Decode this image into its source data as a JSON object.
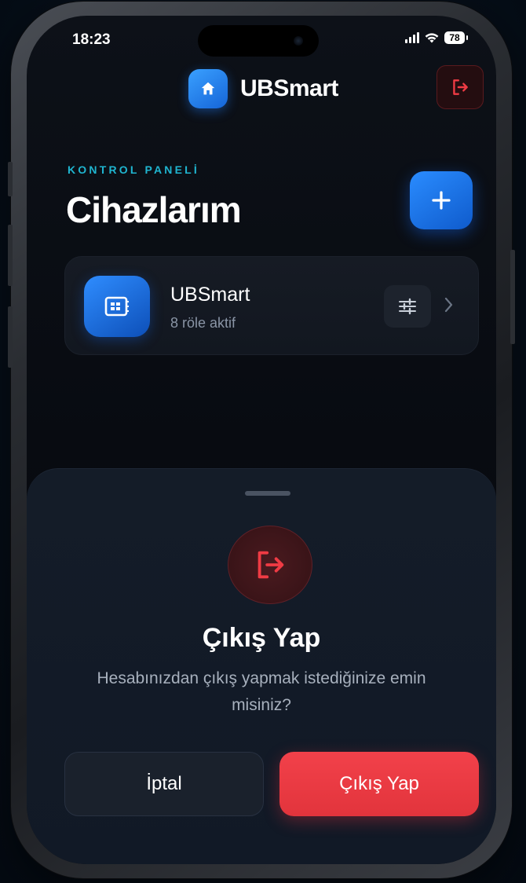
{
  "status_bar": {
    "time": "18:23",
    "battery": "78",
    "signal_icon": "signal-icon",
    "wifi_icon": "wifi-icon"
  },
  "header": {
    "app_name": "UBSmart",
    "logo_icon": "home-icon",
    "logout_icon": "logout-icon"
  },
  "dashboard": {
    "section_label": "KONTROL PANELİ",
    "title": "Cihazlarım",
    "add_icon": "plus-icon"
  },
  "devices": [
    {
      "name": "UBSmart",
      "status": "8 röle aktif",
      "icon": "relay-board-icon"
    }
  ],
  "logout_sheet": {
    "title": "Çıkış Yap",
    "message": "Hesabınızdan çıkış yapmak istediğinize emin misiniz?",
    "cancel_label": "İptal",
    "confirm_label": "Çıkış Yap"
  },
  "colors": {
    "accent_blue": "#1f7ae8",
    "accent_cyan": "#1fb5d0",
    "danger_red": "#ee3b44"
  }
}
